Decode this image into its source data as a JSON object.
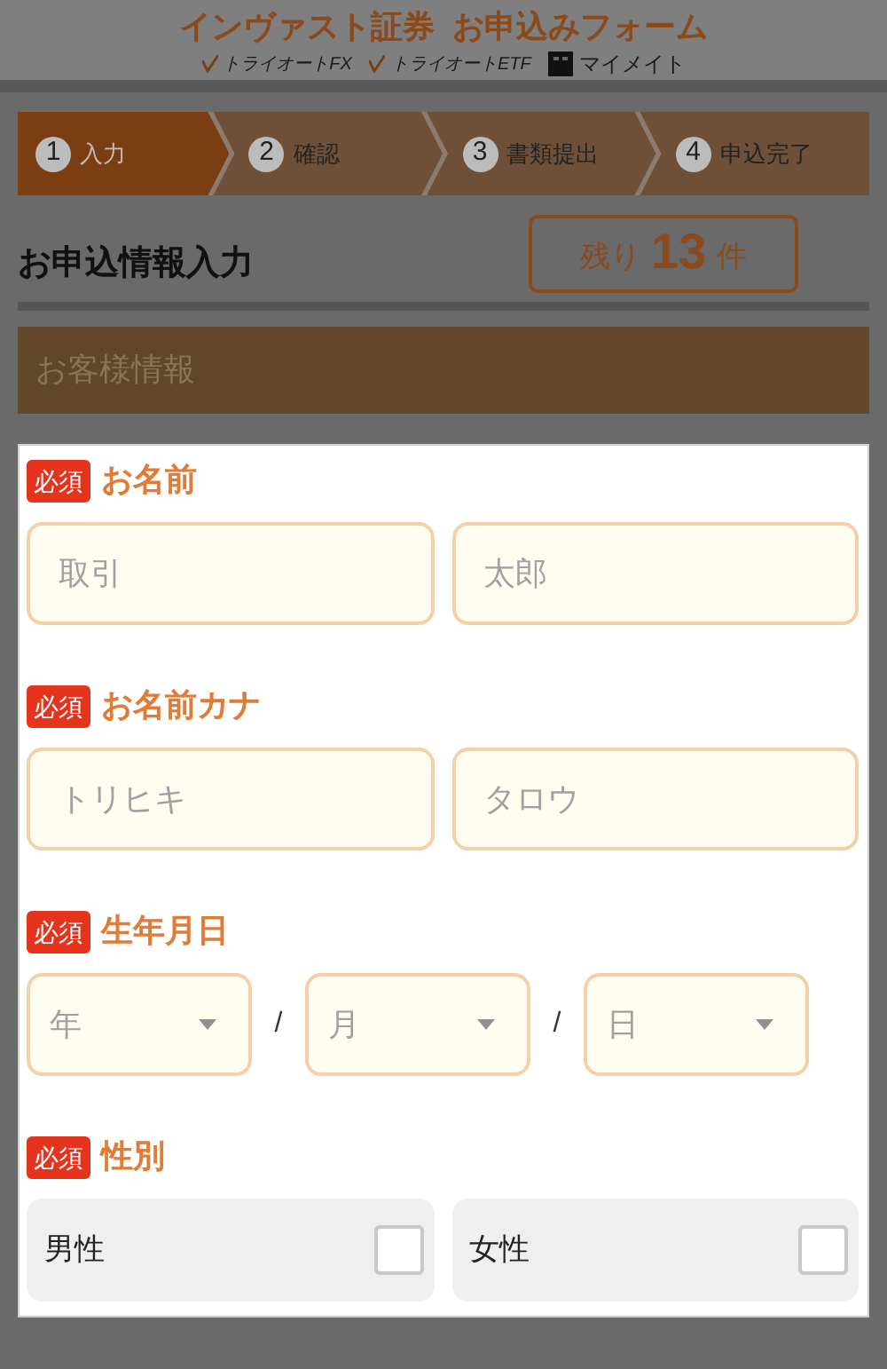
{
  "header": {
    "title": "インヴァスト証券  お申込みフォーム",
    "brands": [
      {
        "kind": "check",
        "label": "トライオートFX"
      },
      {
        "kind": "check",
        "label": "トライオートETF"
      },
      {
        "kind": "square",
        "label": "マイメイト"
      }
    ]
  },
  "steps": [
    {
      "number": "1",
      "label": "入力",
      "selected": true
    },
    {
      "number": "2",
      "label": "確認",
      "selected": false
    },
    {
      "number": "3",
      "label": "書類提出",
      "selected": false
    },
    {
      "number": "4",
      "label": "申込完了",
      "selected": false
    }
  ],
  "heading": "お申込情報入力",
  "remaining": {
    "prefix": "残り",
    "count": "13",
    "suffix": "件"
  },
  "section_title": "お客様情報",
  "fields": [
    {
      "kind": "text",
      "badge": "必須",
      "label": "お名前",
      "inputs": [
        {
          "placeholder": "取引"
        },
        {
          "placeholder": "太郎"
        }
      ]
    },
    {
      "kind": "text",
      "badge": "必須",
      "label": "お名前カナ",
      "inputs": [
        {
          "placeholder": "トリヒキ"
        },
        {
          "placeholder": "タロウ"
        }
      ]
    },
    {
      "kind": "date",
      "badge": "必須",
      "label": "生年月日",
      "selects": [
        {
          "placeholder": "年"
        },
        {
          "placeholder": "月"
        },
        {
          "placeholder": "日"
        }
      ],
      "separators": [
        "/",
        "/"
      ]
    },
    {
      "kind": "choice",
      "badge": "必須",
      "label": "性別",
      "options": [
        {
          "label": "男性",
          "checked": false
        },
        {
          "label": "女性",
          "checked": false
        }
      ]
    }
  ]
}
